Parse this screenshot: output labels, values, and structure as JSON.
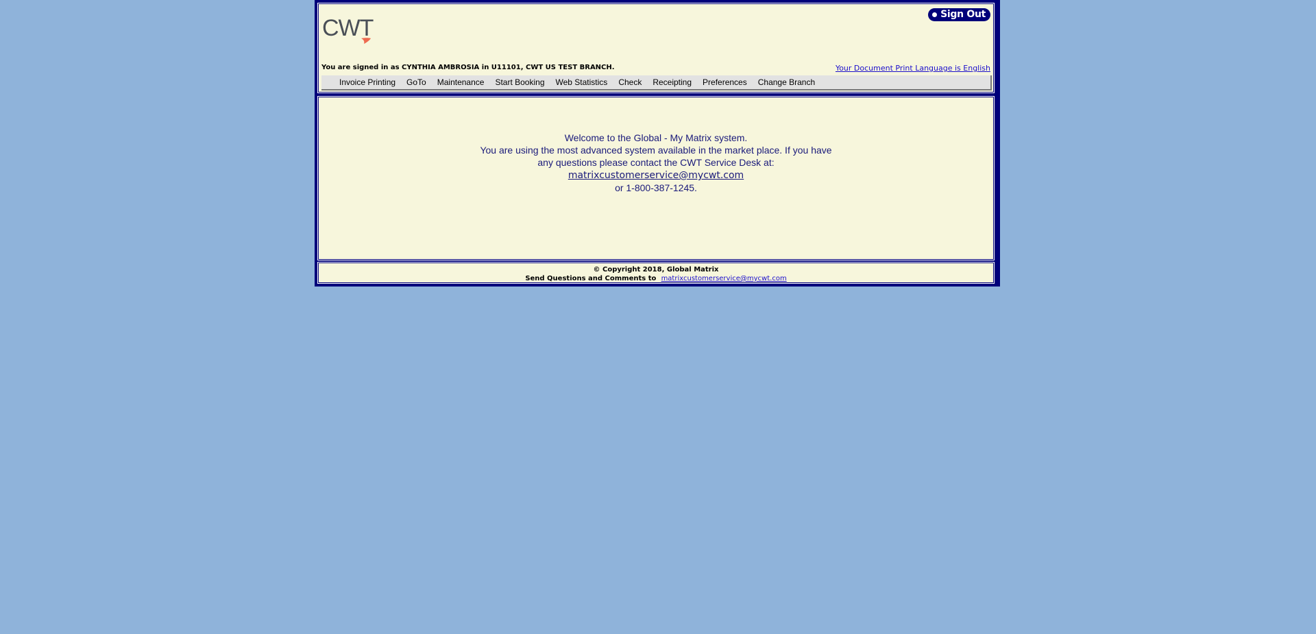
{
  "header": {
    "logo_text": "CWT",
    "signout_label": "Sign Out",
    "signed_in_text": "You are signed in as CYNTHIA AMBROSIA in U11101, CWT US TEST BRANCH.",
    "print_language_link": "Your Document Print Language is English"
  },
  "menu": {
    "items": [
      {
        "label": "Invoice Printing"
      },
      {
        "label": "GoTo"
      },
      {
        "label": "Maintenance"
      },
      {
        "label": "Start Booking"
      },
      {
        "label": "Web Statistics"
      },
      {
        "label": "Check"
      },
      {
        "label": "Receipting"
      },
      {
        "label": "Preferences"
      },
      {
        "label": "Change Branch"
      }
    ]
  },
  "main": {
    "welcome_line1": "Welcome to the Global - My Matrix system.",
    "welcome_line2": "You are using the most advanced system available in the market place. If you have any questions please contact the CWT Service Desk at:",
    "email": "matrixcustomerservice@mycwt.com",
    "phone_line": "or 1-800-387-1245."
  },
  "footer": {
    "copyright": "© Copyright 2018, Global Matrix",
    "send_label": "Send Questions and Comments to",
    "email": "matrixcustomerservice@mycwt.com"
  },
  "colors": {
    "page_background": "#8fb3da",
    "panel_background": "#f7f6dc",
    "frame_navy": "#00007a",
    "logo_gray": "#4a4f57",
    "logo_accent": "#ee6a50"
  }
}
